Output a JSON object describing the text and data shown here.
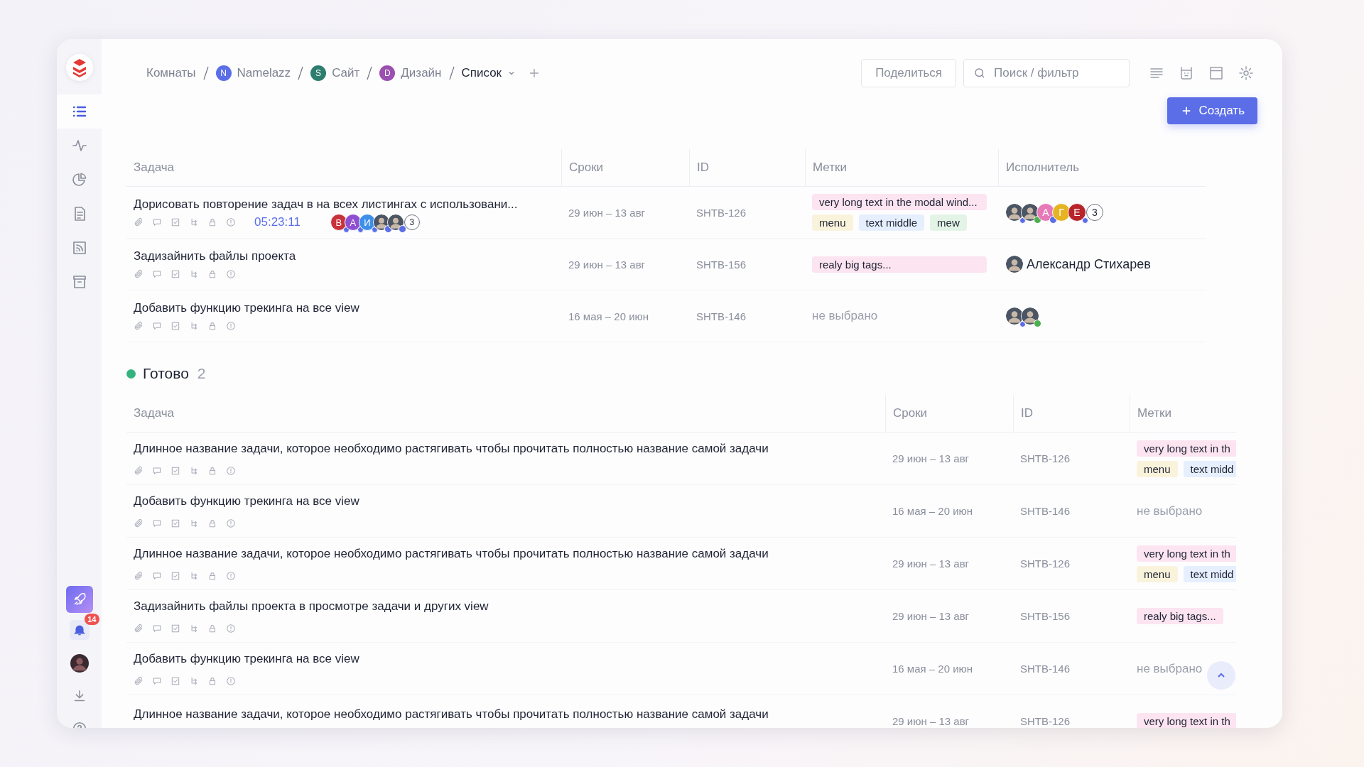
{
  "sidebar": {
    "items": [
      {
        "kind": "list",
        "selected": true
      },
      {
        "kind": "activity",
        "selected": false
      },
      {
        "kind": "pie",
        "selected": false
      },
      {
        "kind": "document",
        "selected": false
      },
      {
        "kind": "rss",
        "selected": false
      },
      {
        "kind": "archive",
        "selected": false
      }
    ],
    "notifications": "14"
  },
  "breadcrumbs": [
    {
      "label": "Комнаты"
    },
    {
      "label": "Namelazz",
      "letter": "N",
      "color": "#5b6ee8"
    },
    {
      "label": "Сайт",
      "letter": "S",
      "color": "#2e7d6f"
    },
    {
      "label": "Дизайн",
      "letter": "D",
      "color": "#9b4fb0"
    }
  ],
  "current_view": "Список",
  "share_button": "Поделиться",
  "search": {
    "placeholder": "Поиск / фильтр"
  },
  "create_button": "Создать",
  "groups": [
    {
      "columns": [
        "Задача",
        "Сроки",
        "ID",
        "Метки",
        "Исполнитель"
      ],
      "rows": [
        {
          "title": "Дорисовать повторение задач в на всех листингах с использовани...",
          "timer": "05:23:11",
          "avatars": [
            {
              "kind": "letter",
              "letter": "В",
              "color": "#c8323a",
              "status": {
                "kind": "dot"
              }
            },
            {
              "kind": "letter",
              "letter": "А",
              "color": "#8e4fd0",
              "status": {
                "kind": "dot"
              }
            },
            {
              "kind": "letter",
              "letter": "И",
              "color": "#3d8fe8",
              "status": {
                "kind": "dot"
              }
            },
            {
              "kind": "photo",
              "status": {
                "kind": "play"
              }
            },
            {
              "kind": "photo",
              "status": {
                "kind": "play"
              }
            }
          ],
          "avatars_more": "3",
          "dates": "29 июн – 13 авг",
          "id": "SHTB-126",
          "tags": [
            {
              "text": "very long text in the modal wind...",
              "color": "#fce4f1"
            },
            {
              "text": "menu",
              "color": "#faf3dc"
            },
            {
              "text": "text middle",
              "color": "#e6effd"
            },
            {
              "text": "mew",
              "color": "#e3f4e6"
            }
          ],
          "assignees": [
            {
              "kind": "photo",
              "status": {
                "kind": "dot"
              }
            },
            {
              "kind": "photo",
              "status": {
                "kind": "check"
              }
            },
            {
              "kind": "letter",
              "letter": "А",
              "color": "#e879b8",
              "status": {
                "kind": "play"
              }
            },
            {
              "kind": "letter",
              "letter": "Г",
              "color": "#e6b422"
            },
            {
              "kind": "letter",
              "letter": "Е",
              "color": "#b8242c",
              "status": {
                "kind": "dot"
              }
            }
          ],
          "assignees_more": "3"
        },
        {
          "title": "Задизайнить файлы проекта",
          "dates": "29 июн – 13 авг",
          "id": "SHTB-156",
          "tags": [
            {
              "text": "realy big tags...",
              "color": "#fce4f1"
            }
          ],
          "assignees": [
            {
              "kind": "photo"
            }
          ],
          "assignee_name": "Александр Стихарев"
        },
        {
          "title": "Добавить функцию трекинга на все view",
          "dates": "16 мая – 20 июн",
          "id": "SHTB-146",
          "tags_empty": "не выбрано",
          "assignees": [
            {
              "kind": "photo",
              "status": {
                "kind": "dot"
              }
            },
            {
              "kind": "photo",
              "status": {
                "kind": "check"
              }
            }
          ]
        }
      ]
    },
    {
      "title": "Готово",
      "count": "2",
      "color": "#34b37e",
      "columns": [
        "Задача",
        "Сроки",
        "ID",
        "Метки"
      ],
      "rows": [
        {
          "title": "Длинное название задачи, которое необходимо растягивать чтобы прочитать полностью название самой задачи",
          "dates": "29 июн – 13 авг",
          "id": "SHTB-126",
          "tags": [
            {
              "text": "very long text in th",
              "color": "#fce4f1"
            },
            {
              "text": "menu",
              "color": "#faf3dc"
            },
            {
              "text": "text midd",
              "color": "#e6effd"
            }
          ]
        },
        {
          "title": "Добавить функцию трекинга на все view",
          "dates": "16 мая – 20 июн",
          "id": "SHTB-146",
          "tags_empty": "не выбрано"
        },
        {
          "title": "Длинное название задачи, которое необходимо растягивать чтобы прочитать полностью название самой задачи",
          "dates": "29 июн – 13 авг",
          "id": "SHTB-126",
          "tags": [
            {
              "text": "very long text in th",
              "color": "#fce4f1"
            },
            {
              "text": "menu",
              "color": "#faf3dc"
            },
            {
              "text": "text midd",
              "color": "#e6effd"
            }
          ]
        },
        {
          "title": "Задизайнить файлы проекта в просмотре задачи и других view",
          "dates": "29 июн – 13 авг",
          "id": "SHTB-156",
          "tags": [
            {
              "text": "realy big tags...",
              "color": "#fce4f1"
            }
          ]
        },
        {
          "title": "Добавить функцию трекинга на все view",
          "dates": "16 мая – 20 июн",
          "id": "SHTB-146",
          "tags_empty": "не выбрано"
        },
        {
          "title": "Длинное название задачи, которое необходимо растягивать чтобы прочитать полностью название самой задачи",
          "dates": "29 июн – 13 авг",
          "id": "SHTB-126",
          "tags": [
            {
              "text": "very long text in th",
              "color": "#fce4f1"
            }
          ],
          "icons": false
        }
      ]
    }
  ]
}
